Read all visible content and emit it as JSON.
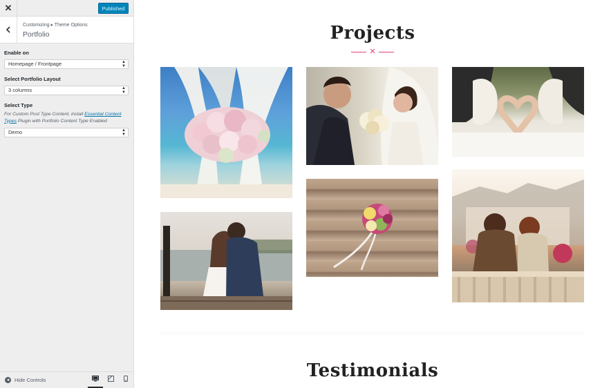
{
  "topbar": {
    "close_icon": "close-icon",
    "publish_label": "Published",
    "accent_color": "#0085ba"
  },
  "section": {
    "breadcrumb": "Customizing ▸ Theme Options",
    "title": "Portfolio"
  },
  "controls": {
    "enable_on": {
      "label": "Enable on",
      "value": "Homepage / Frontpage"
    },
    "layout": {
      "label": "Select Portfolio Layout",
      "value": "3 columns"
    },
    "type": {
      "label": "Select Type",
      "desc_prefix": "For Custom Post Type Content, install ",
      "desc_link": "Essential Content Types",
      "desc_suffix": " Plugin with Portfolio Content Type Enabled",
      "value": "Demo"
    }
  },
  "footer": {
    "hide_controls_label": "Hide Controls",
    "devices": [
      "desktop-icon",
      "tablet-icon",
      "mobile-icon"
    ],
    "active_device": "desktop"
  },
  "preview": {
    "projects_heading": "Projects",
    "divider_glyph": "✕",
    "divider_color": "#e0407a",
    "photos": [
      "wedding-arch-flowers-beach",
      "couple-with-bouquet",
      "hands-heart-shape",
      "couple-on-pier",
      "bouquet-on-steps",
      "couple-on-bench"
    ],
    "testimonials_heading": "Testimonials"
  }
}
